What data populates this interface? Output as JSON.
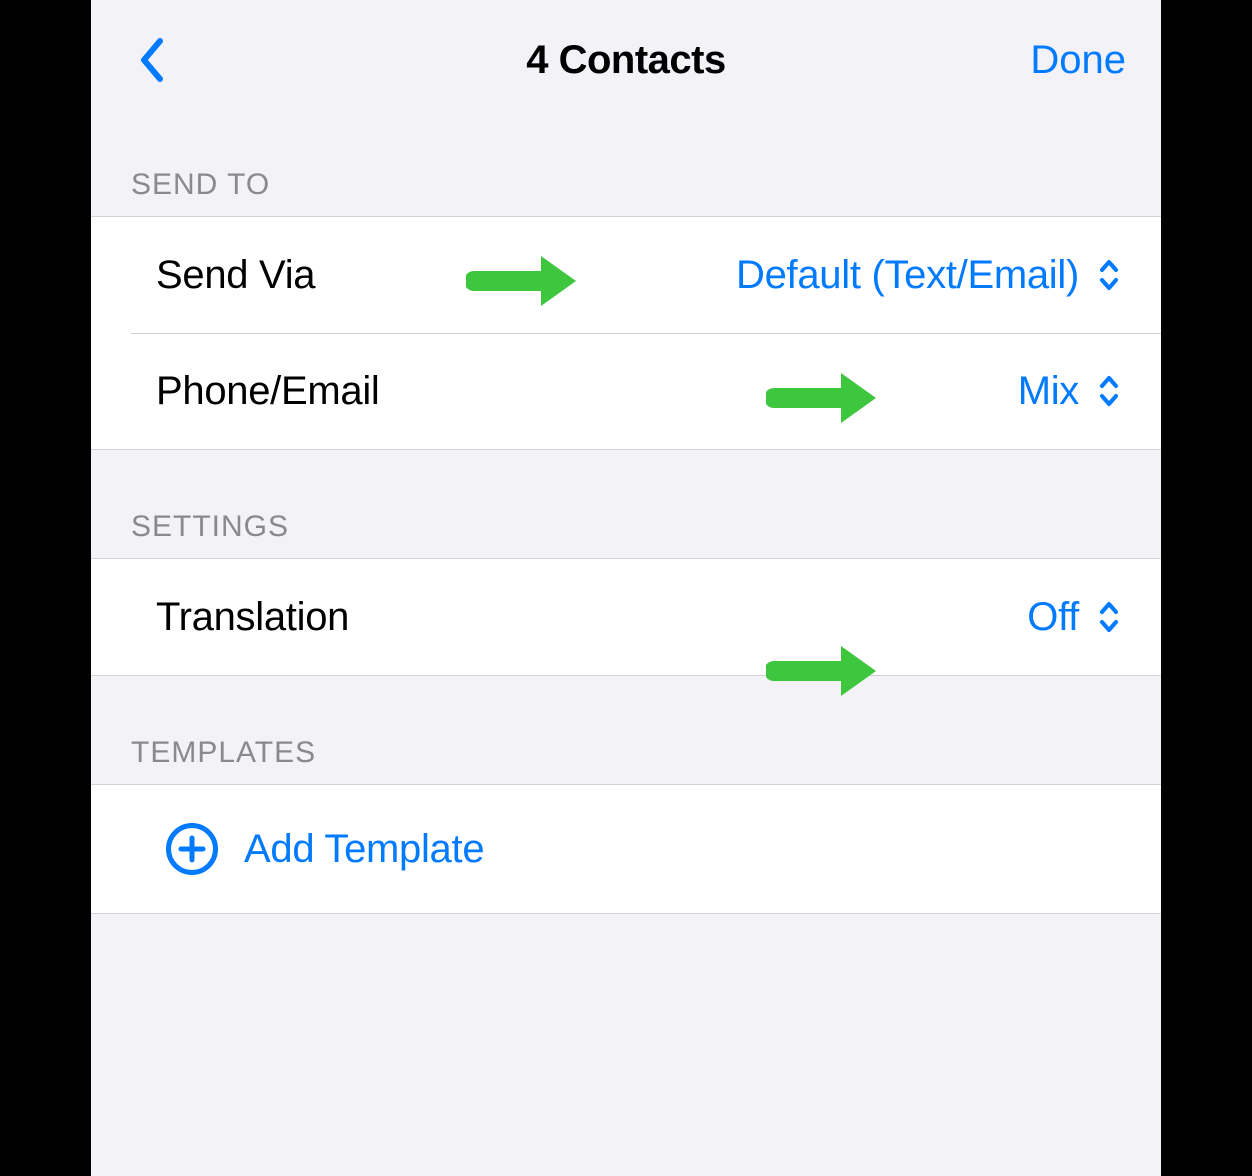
{
  "nav": {
    "title": "4 Contacts",
    "done": "Done"
  },
  "sections": {
    "send_to": {
      "header": "SEND TO",
      "items": [
        {
          "label": "Send Via",
          "value": "Default (Text/Email)"
        },
        {
          "label": "Phone/Email",
          "value": "Mix"
        }
      ]
    },
    "settings": {
      "header": "SETTINGS",
      "items": [
        {
          "label": "Translation",
          "value": "Off"
        }
      ]
    },
    "templates": {
      "header": "TEMPLATES",
      "add_label": "Add Template"
    }
  }
}
